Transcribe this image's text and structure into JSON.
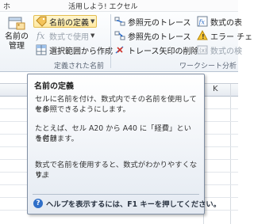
{
  "title_bar": {
    "tab_fragment_left": "ホ",
    "tab_fragment_right": "活用しよう! エクセル"
  },
  "ribbon": {
    "name_manager_label_line1": "名前の",
    "name_manager_label_line2": "管理",
    "define_name_label": "名前の定義",
    "use_in_formula_label": "数式で使用",
    "create_from_selection_label": "選択範囲から作成",
    "defined_names_group_label": "定義された名前",
    "trace_precedents_label": "参照元のトレース",
    "trace_dependents_label": "参照先のトレース",
    "remove_arrows_label": "トレース矢印の削除",
    "show_formulas_label": "数式の表",
    "error_check_label": "エラー チェ",
    "evaluate_formula_label": "数式の検",
    "formula_auditing_group_label": "ワークシート分析"
  },
  "sheet": {
    "visible_column": "K"
  },
  "tooltip": {
    "title": "名前の定義",
    "para1_line1": "セルに名前を付け、数式内でその名前を使用してセル",
    "para1_line2": "を参照できるようにします。",
    "para2_line1": "たとえば、セル A20 から A40 に「経費」という名前",
    "para2_line2": "を付けます。",
    "para3": "数式で名前を使用すると、数式がわかりやすくなりま",
    "para3_line2": "す。",
    "help_text": "ヘルプを表示するには、F1 キーを押してください。"
  },
  "colors": {
    "highlight_fill": "#ffe9a1",
    "help_icon": "#2f6fc8",
    "tooltip_border": "#7f8ea3"
  },
  "icons": [
    "name-manager-icon",
    "tag-icon",
    "formula-icon",
    "grid-select-icon",
    "trace-precedents-icon",
    "trace-dependents-icon",
    "remove-arrows-icon",
    "show-formulas-icon",
    "error-check-icon",
    "evaluate-formula-icon",
    "help-icon"
  ]
}
